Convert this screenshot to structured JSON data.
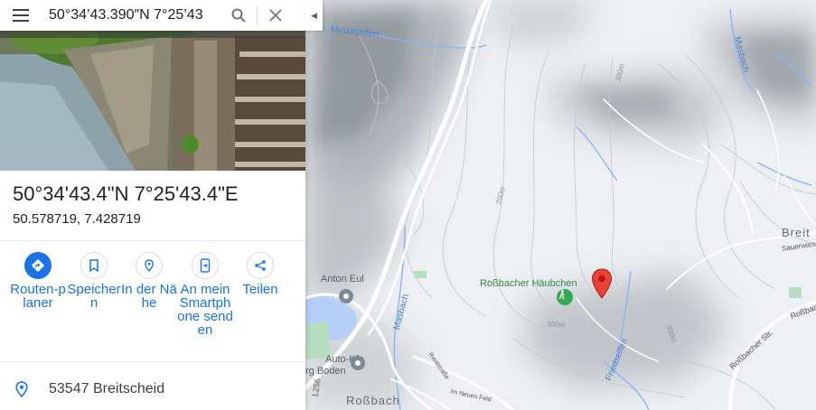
{
  "search": {
    "value": "50°34’43.390″N 7°25’43",
    "menu_icon": "hamburger-menu-icon",
    "search_icon": "magnifier-icon",
    "clear_icon": "close-icon"
  },
  "place": {
    "title": "50°34'43.4\"N 7°25'43.4\"E",
    "decimal": "50.578719, 7.428719",
    "address": "53547 Breitscheid"
  },
  "actions": [
    {
      "label": "Routen-planer",
      "icon": "directions-icon"
    },
    {
      "label": "Speichern",
      "icon": "bookmark-icon"
    },
    {
      "label": "In der Nähe",
      "icon": "nearby-icon"
    },
    {
      "label": "An mein Smartphone senden",
      "icon": "send-to-phone-icon"
    },
    {
      "label": "Teilen",
      "icon": "share-icon"
    }
  ],
  "map": {
    "labels": {
      "minzeseifen": "Minzeseifen",
      "masbach_top": "Masbach",
      "masbach_bottom": "Masbach",
      "anton_eul": "Anton Eul",
      "rossbacher_haeubchen": "Roßbacher Häubchen",
      "breit": "Breit",
      "sauerwiese": "Sauerwiese",
      "rossbacher_str_1": "Roßbacher Str.",
      "rossbacher_str_2": "Roßbacher Str.",
      "auto_kfz": "Auto-Kfz",
      "berg_boden": "rg Boden",
      "l256": "L256",
      "rossbach": "Roßbach",
      "friedseifen": "Friedseifen",
      "im_neuen_feld": "Im Neuen Feld",
      "rentstrasse": "Rentstraße",
      "c300_top": "300m",
      "c200": "200m",
      "c300_mid": "300m",
      "c300_right": "300m"
    },
    "colors": {
      "water": "#4a7fc9",
      "pin": "#ea4335",
      "park": "#34a853"
    }
  }
}
